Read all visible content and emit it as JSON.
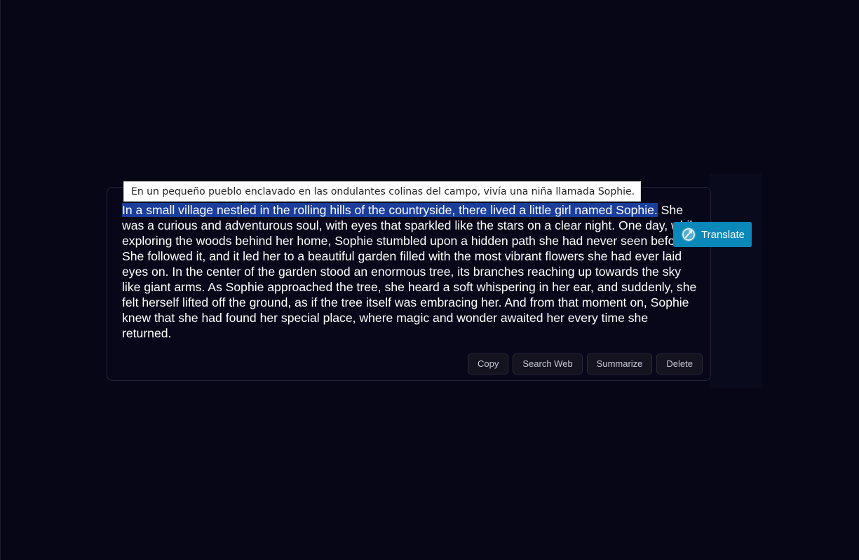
{
  "tooltip": {
    "translation_text": "En un pequeño pueblo enclavado en las ondulantes colinas del campo, vivía una niña llamada Sophie."
  },
  "story": {
    "selected_text": "In a small village nestled in the rolling hills of the countryside, there lived a little girl named Sophie.",
    "rest_text": " She was a curious and adventurous soul, with eyes that sparkled like the stars on a clear night. One day, while exploring the woods behind her home, Sophie stumbled upon a hidden path she had never seen before. She followed it, and it led her to a beautiful garden filled with the most vibrant flowers she had ever laid eyes on. In the center of the garden stood an enormous tree, its branches reaching up towards the sky like giant arms. As Sophie approached the tree, she heard a soft whispering in her ear, and suddenly, she felt herself lifted off the ground, as if the tree itself was embracing her. And from that moment on, Sophie knew that she had found her special place, where magic and wonder awaited her every time she returned."
  },
  "translate_button": {
    "label": "Translate",
    "icon": "translate-icon"
  },
  "actions": {
    "copy_label": "Copy",
    "search_web_label": "Search Web",
    "summarize_label": "Summarize",
    "delete_label": "Delete"
  },
  "colors": {
    "background": "#070617",
    "selection": "#1b3d9c",
    "translate_button": "#0a88b9"
  }
}
